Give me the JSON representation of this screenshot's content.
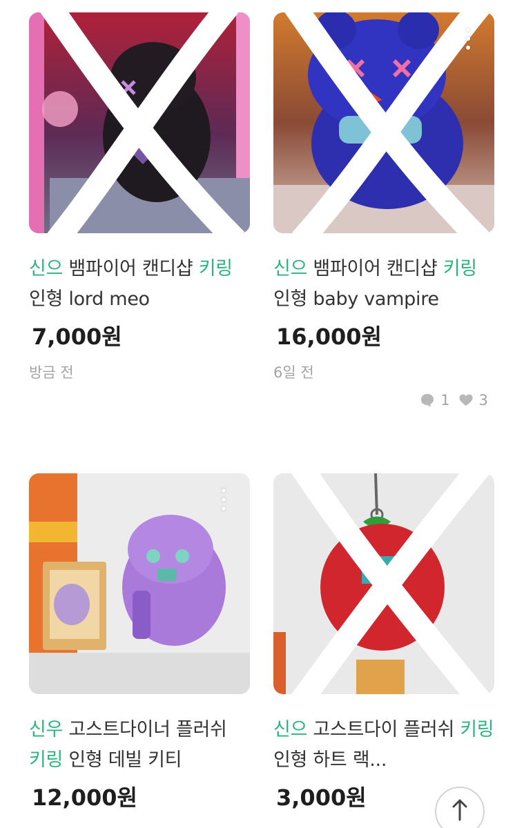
{
  "products": [
    {
      "title_parts": [
        {
          "text": "신으",
          "highlight": true
        },
        {
          "text": " 뱀파이어 ",
          "highlight": false
        },
        {
          "text": "캔디샵 ",
          "highlight": false
        },
        {
          "text": "키링",
          "highlight": true
        },
        {
          "text": " 인형 lord meo",
          "highlight": false
        }
      ],
      "price": "7,000원",
      "time": "방금 전",
      "crossed_out": true,
      "image_theme": "black plush"
    },
    {
      "title_parts": [
        {
          "text": "신으",
          "highlight": true
        },
        {
          "text": " 뱀파이어 캔디샵 ",
          "highlight": false
        },
        {
          "text": "키링",
          "highlight": true
        },
        {
          "text": " 인형 baby vampire",
          "highlight": false
        }
      ],
      "price": "16,000원",
      "time": "6일 전",
      "chats": "1",
      "likes": "3",
      "crossed_out": true,
      "image_theme": "blue plush"
    },
    {
      "title_parts": [
        {
          "text": "신우",
          "highlight": true
        },
        {
          "text": " 고스트다이너 플러쉬 ",
          "highlight": false
        },
        {
          "text": "키링",
          "highlight": true
        },
        {
          "text": " 인형 데빌 키티",
          "highlight": false
        }
      ],
      "price": "12,000원",
      "time": "",
      "crossed_out": false,
      "image_theme": "purple plush"
    },
    {
      "title_parts": [
        {
          "text": "신으",
          "highlight": true
        },
        {
          "text": " 고스트다이 플러쉬 ",
          "highlight": false
        },
        {
          "text": "키링",
          "highlight": true
        },
        {
          "text": " 인형 하트 랙...",
          "highlight": false
        }
      ],
      "price": "3,000원",
      "time": "",
      "crossed_out": true,
      "image_theme": "red strawberry plush"
    }
  ],
  "icons": {
    "more": "more-vertical-icon",
    "chat": "chat-bubble-icon",
    "like": "heart-icon",
    "scroll_top": "arrow-up-icon"
  },
  "colors": {
    "keyword_highlight": "#2bb57e",
    "price": "#1e1e1e",
    "meta": "#a3a3a3"
  }
}
